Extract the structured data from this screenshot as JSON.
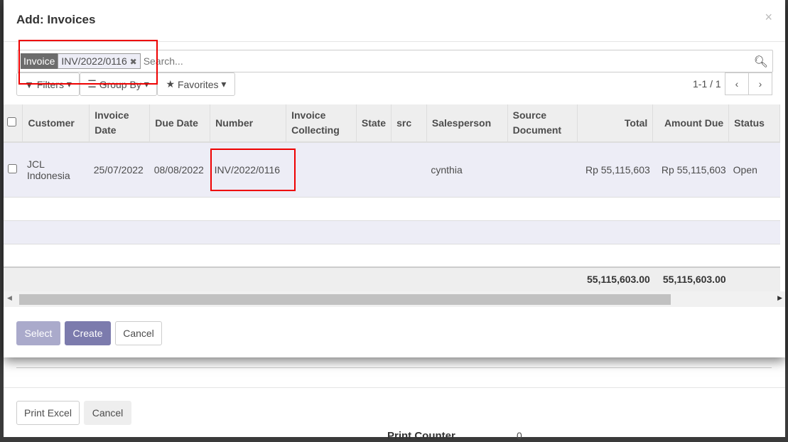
{
  "modal": {
    "title": "Add: Invoices",
    "close": "×"
  },
  "search": {
    "facet_label": "Invoice",
    "facet_value": "INV/2022/0116",
    "facet_remove": "✖",
    "placeholder": "Search..."
  },
  "toolbar": {
    "filters": "Filters",
    "group_by": "Group By",
    "favorites": "Favorites",
    "pager": "1-1 / 1"
  },
  "table": {
    "headers": [
      "Customer",
      "Invoice Date",
      "Due Date",
      "Number",
      "Invoice Collecting",
      "State",
      "src",
      "Salesperson",
      "Source Document",
      "Total",
      "Amount Due",
      "Status"
    ],
    "rows": [
      {
        "customer": "JCL Indonesia",
        "invoice_date": "25/07/2022",
        "due_date": "08/08/2022",
        "number": "INV/2022/0116",
        "invoice_collecting": "",
        "state": "",
        "src": "",
        "salesperson": "cynthia",
        "source_document": "",
        "total": "Rp 55,115,603",
        "amount_due": "Rp 55,115,603",
        "status": "Open"
      }
    ],
    "footer": {
      "total": "55,115,603.00",
      "amount_due": "55,115,603.00"
    }
  },
  "buttons": {
    "select": "Select",
    "create": "Create",
    "cancel": "Cancel"
  },
  "background": {
    "print_excel": "Print Excel",
    "cancel": "Cancel",
    "print_counter": "Print Counter",
    "counter_value": "0"
  },
  "colors": {
    "primary": "#7c7bad",
    "primary_disabled": "#aaaacb",
    "highlight": "#ee0000"
  }
}
